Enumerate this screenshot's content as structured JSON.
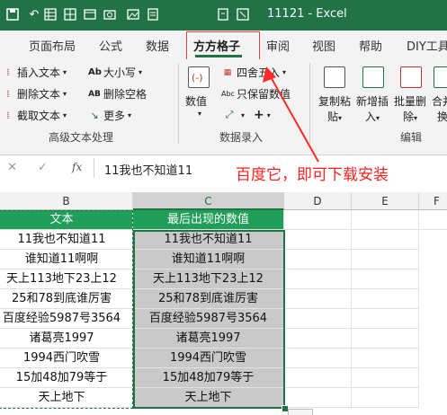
{
  "titlebar": {
    "doc_title": "11121  -  Excel",
    "icons": [
      "save-icon",
      "undo-icon",
      "table-icon",
      "grid-icon",
      "layout-icon",
      "camera-icon",
      "image-icon",
      "document-icon",
      "text-icon",
      "format-icon"
    ],
    "colors": {
      "bg": "#217346",
      "fg": "#ffffff"
    }
  },
  "tabs": [
    {
      "label": "页面布局"
    },
    {
      "label": "公式"
    },
    {
      "label": "数据"
    },
    {
      "label": "方方格子",
      "active": true
    },
    {
      "label": "审阅"
    },
    {
      "label": "视图"
    },
    {
      "label": "帮助"
    },
    {
      "label": "DIY工具"
    }
  ],
  "ribbon": {
    "text_group": {
      "label": "高级文本处理",
      "insert_text": "插入文本",
      "delete_text": "删除文本",
      "cut_text": "截取文本",
      "case": "大小写",
      "delete_space": "删除空格",
      "more": "更多"
    },
    "number_group": {
      "label": "数据录入",
      "numeric": "数值",
      "round": "四舍五入",
      "keep_numbers": "只保留数值",
      "plus": "+"
    },
    "edit_group": {
      "label": "编辑",
      "copy_paste_line1": "复制粘",
      "copy_paste_line2": "贴",
      "new_insert_line1": "新增插",
      "new_insert_line2": "入",
      "batch_delete_line1": "批量删",
      "batch_delete_line2": "除",
      "merge_line1": "合并",
      "merge_line2": "换"
    }
  },
  "formula_bar": {
    "cancel": "✕",
    "confirm": "✓",
    "fx": "fx",
    "value": "11我也不知道11"
  },
  "annotation": "百度它，即可下载安装",
  "sheet": {
    "columns": [
      "B",
      "C",
      "D",
      "E",
      "F"
    ],
    "header_b": "文本",
    "header_c": "最后出现的数值",
    "rows": [
      {
        "b": "11我也不知道11",
        "c": "11我也不知道11"
      },
      {
        "b": "谁知道11啊啊",
        "c": "谁知道11啊啊"
      },
      {
        "b": "天上113地下23上12",
        "c": "天上113地下23上12"
      },
      {
        "b": "25和78到底谁厉害",
        "c": "25和78到底谁厉害"
      },
      {
        "b": "百度经验5987号3564",
        "c": "百度经验5987号3564"
      },
      {
        "b": "诸葛亮1997",
        "c": "诸葛亮1997"
      },
      {
        "b": "1994西门吹雪",
        "c": "1994西门吹雪"
      },
      {
        "b": "15加48加79等于",
        "c": "15加48加79等于"
      },
      {
        "b": "天上地下",
        "c": "天上地下"
      }
    ]
  }
}
